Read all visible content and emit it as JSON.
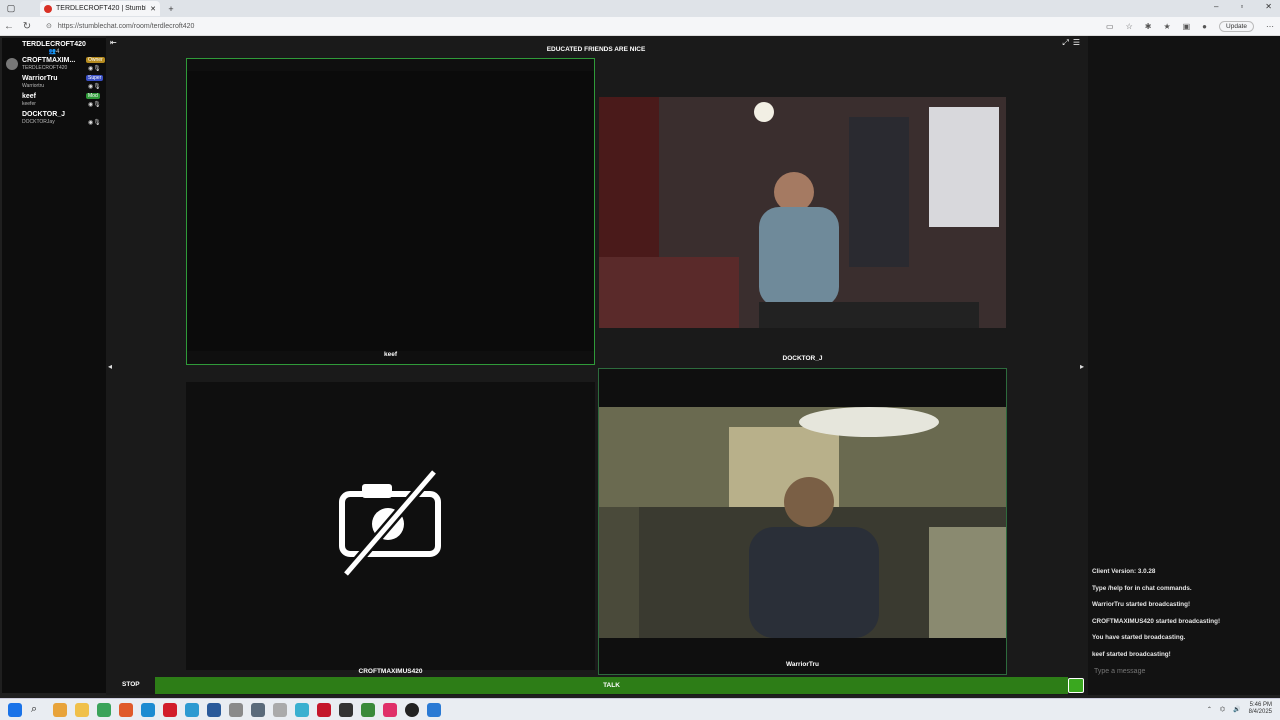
{
  "browser": {
    "tab_title": "TERDLECROFT420 | Stumble",
    "url": "https://stumblechat.com/room/terdlecroft420",
    "update_label": "Update"
  },
  "room": {
    "title": "TERDLECROFT420",
    "viewer_count": "4",
    "topic": "EDUCATED FRIENDS ARE NICE"
  },
  "users": [
    {
      "name": "CROFTMAXIM...",
      "handle": "TERDLECROFT420",
      "badge": "Owner",
      "badge_color": "#b58b1f"
    },
    {
      "name": "WarriorTru",
      "handle": "Warriortru",
      "badge": "Super",
      "badge_color": "#3a4fc4"
    },
    {
      "name": "keef",
      "handle": "keefer",
      "badge": "Mod",
      "badge_color": "#2f9a39"
    },
    {
      "name": "DOCKTOR_J",
      "handle": "DOCKTORJay",
      "badge": "",
      "badge_color": ""
    }
  ],
  "tiles": [
    {
      "label": "keef",
      "state": "active-empty"
    },
    {
      "label": "DOCKTOR_J",
      "state": "video"
    },
    {
      "label": "CROFTMAXIMUS420",
      "state": "camera-off"
    },
    {
      "label": "WarriorTru",
      "state": "video"
    }
  ],
  "chat": {
    "messages": [
      "Client Version: 3.0.28",
      "Type /help for in chat commands.",
      "WarriorTru started broadcasting!",
      "CROFTMAXIMUS420 started broadcasting!",
      "You have started broadcasting.",
      "keef started broadcasting!"
    ],
    "placeholder": "Type a message"
  },
  "controls": {
    "stop_label": "STOP",
    "talk_label": "TALK"
  },
  "tray": {
    "time": "5:46 PM",
    "date": "8/4/2025"
  }
}
